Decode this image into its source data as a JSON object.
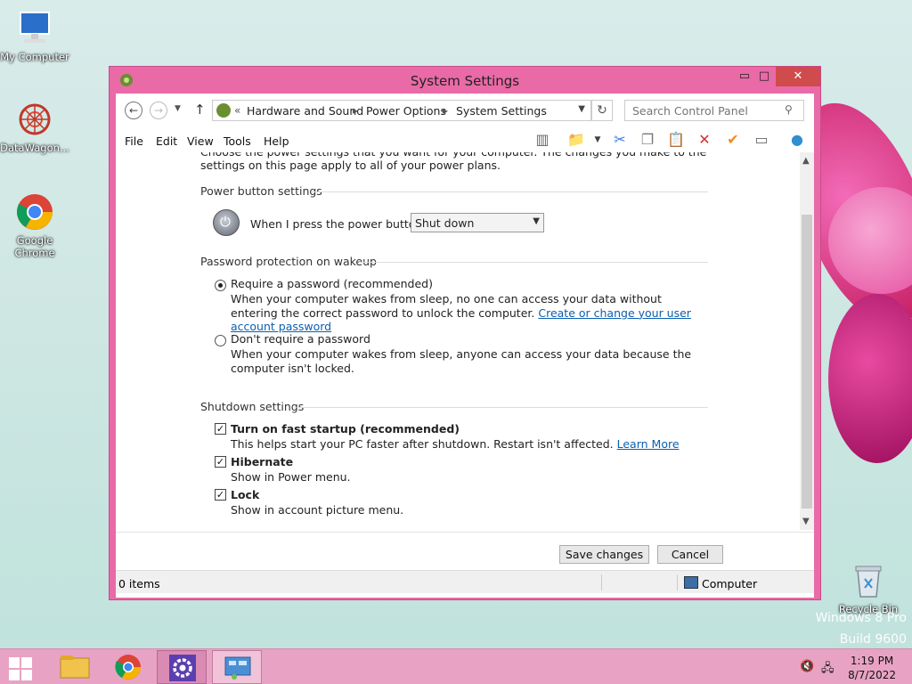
{
  "desktop": {
    "icons": [
      {
        "label": "My Computer"
      },
      {
        "label": "DataWagon..."
      },
      {
        "label": "Google Chrome"
      },
      {
        "label": "Recycle Bin"
      }
    ],
    "watermark_line1": "Windows 8 Pro",
    "watermark_line2": "Build 9600"
  },
  "window": {
    "title": "System Settings",
    "minimize": "▭",
    "maximize": "□",
    "close": "✕"
  },
  "address": {
    "breadcrumb": [
      "Hardware and Sound",
      "Power Options",
      "System Settings"
    ],
    "search_placeholder": "Search Control Panel"
  },
  "menu": {
    "items": [
      "File",
      "Edit",
      "View",
      "Tools",
      "Help"
    ]
  },
  "content": {
    "intro": "Choose the power settings that you want for your computer. The changes you make to the settings on this page apply to all of your power plans.",
    "power_section": "Power button settings",
    "power_label": "When I press the power button:",
    "power_value": "Shut down",
    "password_section": "Password protection on wakeup",
    "require_label": "Require a password (recommended)",
    "require_desc": "When your computer wakes from sleep, no one can access your data without entering the correct password to unlock the computer.",
    "require_link": "Create or change your user account password",
    "norequire_label": "Don't require a password",
    "norequire_desc": "When your computer wakes from sleep, anyone can access your data because the computer isn't locked.",
    "shutdown_section": "Shutdown settings",
    "fast_label": "Turn on fast startup (recommended)",
    "fast_desc": "This helps start your PC faster after shutdown. Restart isn't affected.",
    "fast_link": "Learn More",
    "hibernate_label": "Hibernate",
    "hibernate_desc": "Show in Power menu.",
    "lock_label": "Lock",
    "lock_desc": "Show in account picture menu."
  },
  "buttons": {
    "save": "Save changes",
    "cancel": "Cancel"
  },
  "status": {
    "items": "0 items",
    "location": "Computer"
  },
  "taskbar": {
    "time": "1:19 PM",
    "date": "8/7/2022"
  },
  "colors": {
    "window_frame": "#e96aa6",
    "close_button": "#d04b4b",
    "taskbar": "#e8a3c4",
    "link": "#0b5fb0"
  }
}
